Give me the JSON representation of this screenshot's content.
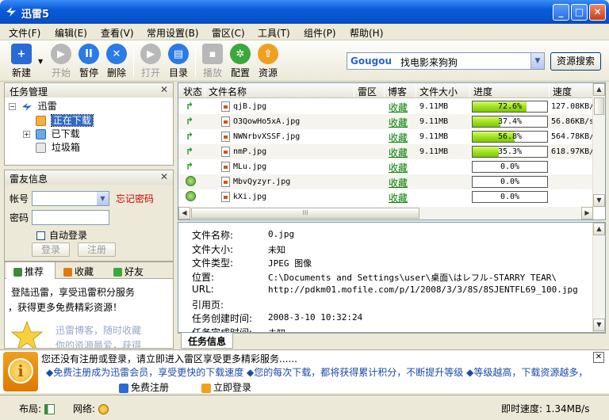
{
  "window": {
    "title": "迅雷5"
  },
  "menu": [
    {
      "label": "文件(F)"
    },
    {
      "label": "编辑(E)"
    },
    {
      "label": "查看(V)"
    },
    {
      "label": "常用设置(B)"
    },
    {
      "label": "雷区(C)"
    },
    {
      "label": "工具(T)"
    },
    {
      "label": "组件(P)"
    },
    {
      "label": "帮助(H)"
    }
  ],
  "toolbar": {
    "new": "新建",
    "start": "开始",
    "pause": "暂停",
    "delete": "删除",
    "open": "打开",
    "directory": "目录",
    "play": "播放",
    "config": "配置",
    "resources": "资源"
  },
  "search": {
    "logo": "Gougou",
    "value": "找电影来狗狗",
    "button": "资源搜索"
  },
  "task_panel": {
    "title": "任务管理",
    "root": "迅雷",
    "nodes": [
      "正在下载",
      "已下载",
      "垃圾箱"
    ]
  },
  "account_panel": {
    "title": "雷友信息",
    "account_label": "帐号",
    "forgot": "忘记密码",
    "password_label": "密码",
    "auto_login": "自动登录",
    "login_btn": "登录",
    "register_btn": "注册",
    "tabs": [
      "推荐",
      "收藏",
      "好友"
    ],
    "promo_line1": "登陆迅雷，享受迅雷积分服务",
    "promo_line2": "，获得更多免费精彩资源！",
    "promo_faded1": "迅雷博客，随时收藏",
    "promo_faded2": "你的资源最爱，获得"
  },
  "list": {
    "headers": [
      "状态",
      "文件名称",
      "雷区",
      "博客",
      "文件大小",
      "进度",
      "速度"
    ],
    "rows": [
      {
        "status": "run",
        "name": "qjB.jpg",
        "blog": "收藏",
        "size": "9.11MB",
        "progress_text": "72.6%",
        "progress": 0.726,
        "speed": "127.08KB/s"
      },
      {
        "status": "run",
        "name": "O3QowHo5xA.jpg",
        "blog": "收藏",
        "size": "9.11MB",
        "progress_text": "37.4%",
        "progress": 0.374,
        "speed": "56.86KB/s"
      },
      {
        "status": "run",
        "name": "NWNrbvXSSF.jpg",
        "blog": "收藏",
        "size": "9.11MB",
        "progress_text": "56.8%",
        "progress": 0.568,
        "speed": "564.78KB/s"
      },
      {
        "status": "run",
        "name": "nmP.jpg",
        "blog": "收藏",
        "size": "9.11MB",
        "progress_text": "35.3%",
        "progress": 0.353,
        "speed": "618.97KB/s"
      },
      {
        "status": "run",
        "name": "MLu.jpg",
        "blog": "收藏",
        "size": "",
        "progress_text": "0.0%",
        "progress": 0,
        "speed": ""
      },
      {
        "status": "wait",
        "name": "MbvQyzyr.jpg",
        "blog": "收藏",
        "size": "",
        "progress_text": "0.0%",
        "progress": 0,
        "speed": ""
      },
      {
        "status": "wait",
        "name": "kXi.jpg",
        "blog": "收藏",
        "size": "",
        "progress_text": "0.0%",
        "progress": 0,
        "speed": ""
      }
    ],
    "scroll_mark": "III"
  },
  "details": {
    "rows": [
      {
        "label": "文件名称:",
        "value": "0.jpg"
      },
      {
        "label": "文件大小:",
        "value": "未知"
      },
      {
        "label": "文件类型:",
        "value": "JPEG 图像"
      },
      {
        "label": "位置:",
        "value": "C:\\Documents and Settings\\user\\桌面\\はレフル-STARRY TEAR\\"
      },
      {
        "label": "URL:",
        "value": "http://pdkm01.mofile.com/p/1/2008/3/3/8S/8SJENTFL69_100.jpg"
      },
      {
        "label": "引用页:",
        "value": ""
      },
      {
        "label": "任务创建时间:",
        "value": "2008-3-10 10:32:24"
      },
      {
        "label": "任务完成时间:",
        "value": "未知"
      }
    ],
    "tab": "任务信息"
  },
  "notice": {
    "line1": "您还没有注册或登录，请立即进入雷区享受更多精彩服务......",
    "line2": "◆免费注册成为迅雷会员，享受更快的下载速度  ◆您的每次下载，都将获得累计积分，不断提升等级  ◆等级越高，下载资源越多，",
    "register": "免费注册",
    "login": "立即登录"
  },
  "status": {
    "layout": "布局:",
    "network": "网络:",
    "speed_label": "即时速度:",
    "speed_value": "1.34MB/s"
  }
}
